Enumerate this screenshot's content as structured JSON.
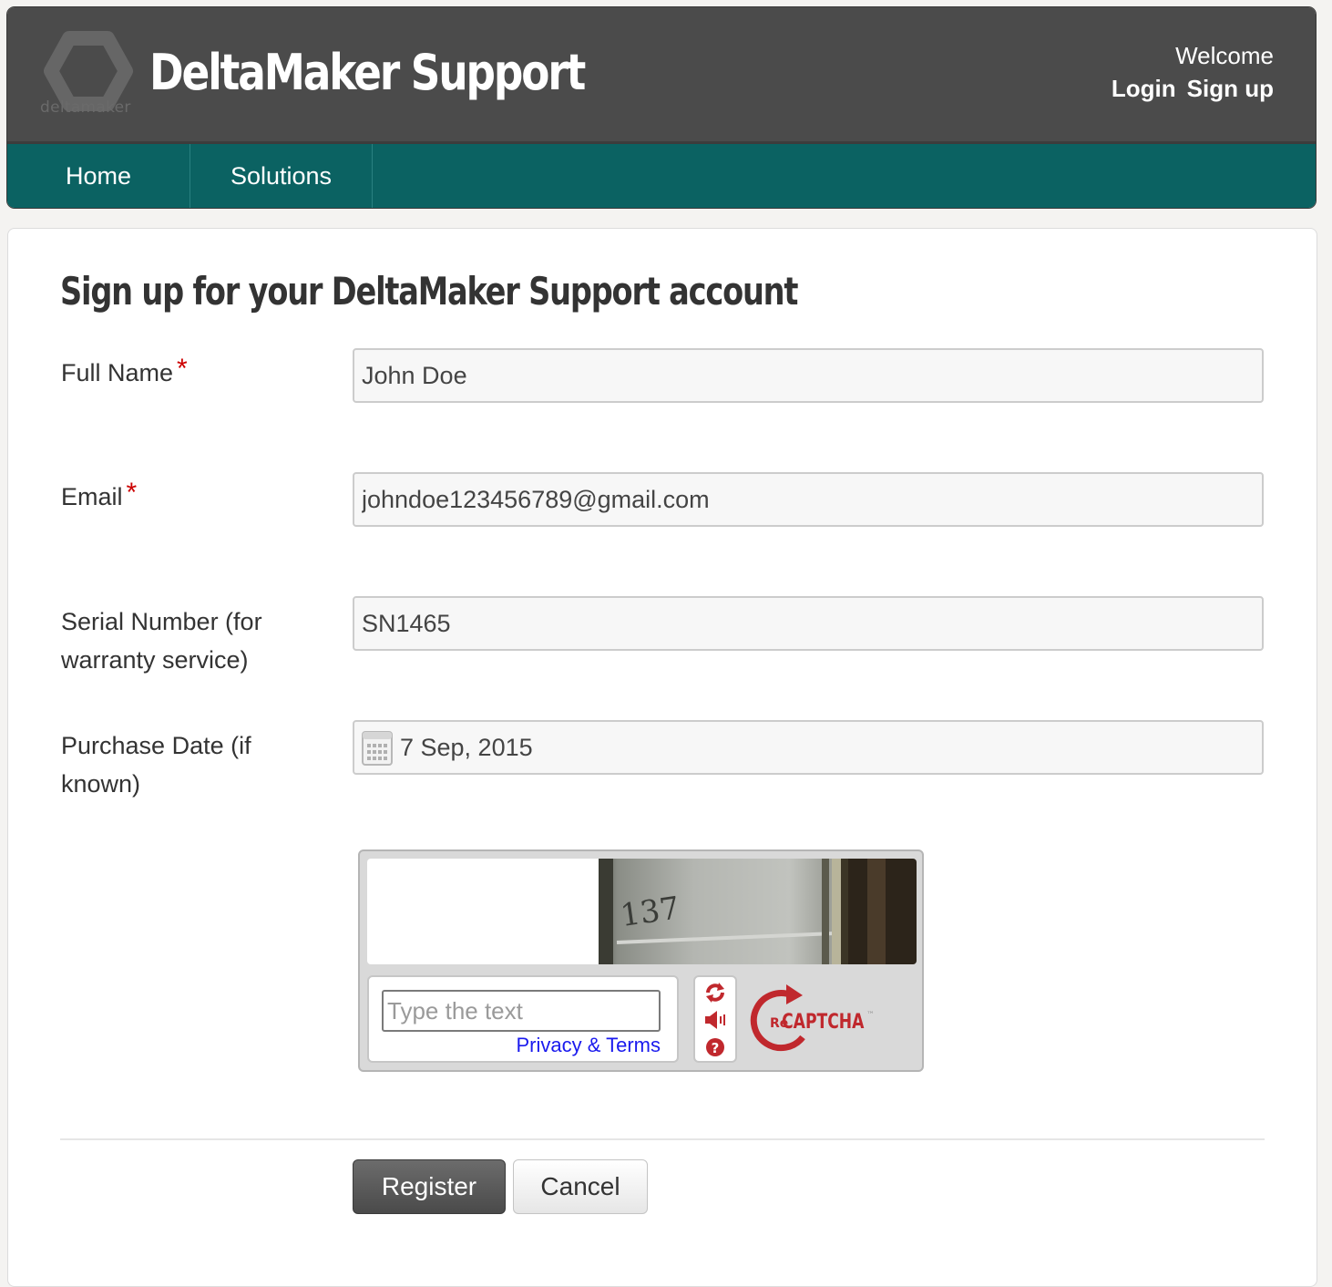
{
  "header": {
    "logo_text": "deltamaker",
    "site_title": "DeltaMaker Support",
    "welcome": "Welcome",
    "login": "Login",
    "signup": "Sign up"
  },
  "nav": {
    "items": [
      {
        "label": "Home"
      },
      {
        "label": "Solutions"
      }
    ]
  },
  "form": {
    "title": "Sign up for your DeltaMaker Support account",
    "full_name": {
      "label": "Full Name",
      "required": "*",
      "value": "John Doe"
    },
    "email": {
      "label": "Email",
      "required": "*",
      "value": "johndoe123456789@gmail.com"
    },
    "serial": {
      "label_line1": "Serial Number (for",
      "label_line2": "warranty service)",
      "value": "SN1465"
    },
    "purchase_date": {
      "label_line1": "Purchase Date (if",
      "label_line2": "known)",
      "value": "7 Sep, 2015"
    }
  },
  "captcha": {
    "image_text": "137",
    "placeholder": "Type the text",
    "privacy_link": "Privacy & Terms",
    "brand_re": "Re",
    "brand_captcha": "CAPTCHA",
    "brand_tm": "™",
    "icons": [
      "refresh-icon",
      "audio-icon",
      "help-icon"
    ]
  },
  "buttons": {
    "register": "Register",
    "cancel": "Cancel"
  },
  "colors": {
    "topbar": "#4b4b4b",
    "navbar": "#0b6262",
    "required": "#cc0000",
    "recaptcha_red": "#c0282d",
    "link_blue": "#1a1aee"
  }
}
